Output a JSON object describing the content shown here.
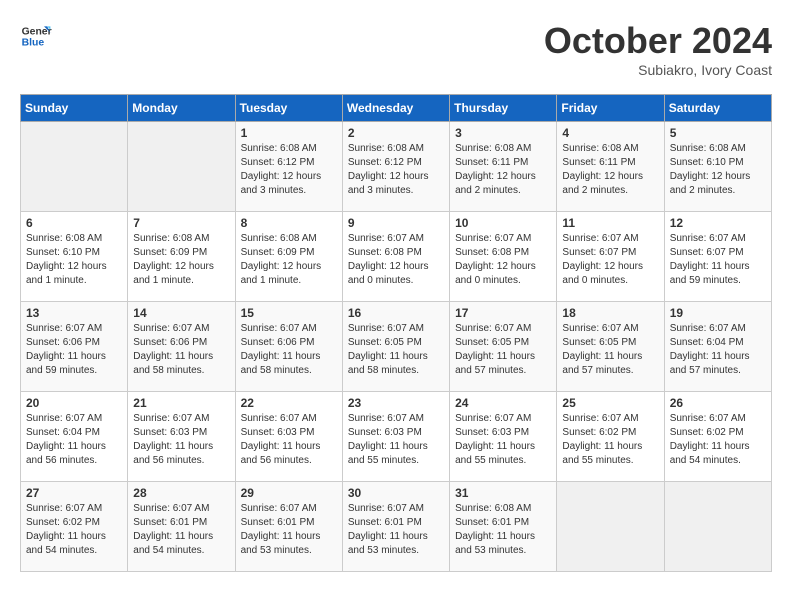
{
  "logo": {
    "line1": "General",
    "line2": "Blue"
  },
  "title": "October 2024",
  "subtitle": "Subiakro, Ivory Coast",
  "days_of_week": [
    "Sunday",
    "Monday",
    "Tuesday",
    "Wednesday",
    "Thursday",
    "Friday",
    "Saturday"
  ],
  "weeks": [
    [
      {
        "day": "",
        "info": ""
      },
      {
        "day": "",
        "info": ""
      },
      {
        "day": "1",
        "info": "Sunrise: 6:08 AM\nSunset: 6:12 PM\nDaylight: 12 hours and 3 minutes."
      },
      {
        "day": "2",
        "info": "Sunrise: 6:08 AM\nSunset: 6:12 PM\nDaylight: 12 hours and 3 minutes."
      },
      {
        "day": "3",
        "info": "Sunrise: 6:08 AM\nSunset: 6:11 PM\nDaylight: 12 hours and 2 minutes."
      },
      {
        "day": "4",
        "info": "Sunrise: 6:08 AM\nSunset: 6:11 PM\nDaylight: 12 hours and 2 minutes."
      },
      {
        "day": "5",
        "info": "Sunrise: 6:08 AM\nSunset: 6:10 PM\nDaylight: 12 hours and 2 minutes."
      }
    ],
    [
      {
        "day": "6",
        "info": "Sunrise: 6:08 AM\nSunset: 6:10 PM\nDaylight: 12 hours and 1 minute."
      },
      {
        "day": "7",
        "info": "Sunrise: 6:08 AM\nSunset: 6:09 PM\nDaylight: 12 hours and 1 minute."
      },
      {
        "day": "8",
        "info": "Sunrise: 6:08 AM\nSunset: 6:09 PM\nDaylight: 12 hours and 1 minute."
      },
      {
        "day": "9",
        "info": "Sunrise: 6:07 AM\nSunset: 6:08 PM\nDaylight: 12 hours and 0 minutes."
      },
      {
        "day": "10",
        "info": "Sunrise: 6:07 AM\nSunset: 6:08 PM\nDaylight: 12 hours and 0 minutes."
      },
      {
        "day": "11",
        "info": "Sunrise: 6:07 AM\nSunset: 6:07 PM\nDaylight: 12 hours and 0 minutes."
      },
      {
        "day": "12",
        "info": "Sunrise: 6:07 AM\nSunset: 6:07 PM\nDaylight: 11 hours and 59 minutes."
      }
    ],
    [
      {
        "day": "13",
        "info": "Sunrise: 6:07 AM\nSunset: 6:06 PM\nDaylight: 11 hours and 59 minutes."
      },
      {
        "day": "14",
        "info": "Sunrise: 6:07 AM\nSunset: 6:06 PM\nDaylight: 11 hours and 58 minutes."
      },
      {
        "day": "15",
        "info": "Sunrise: 6:07 AM\nSunset: 6:06 PM\nDaylight: 11 hours and 58 minutes."
      },
      {
        "day": "16",
        "info": "Sunrise: 6:07 AM\nSunset: 6:05 PM\nDaylight: 11 hours and 58 minutes."
      },
      {
        "day": "17",
        "info": "Sunrise: 6:07 AM\nSunset: 6:05 PM\nDaylight: 11 hours and 57 minutes."
      },
      {
        "day": "18",
        "info": "Sunrise: 6:07 AM\nSunset: 6:05 PM\nDaylight: 11 hours and 57 minutes."
      },
      {
        "day": "19",
        "info": "Sunrise: 6:07 AM\nSunset: 6:04 PM\nDaylight: 11 hours and 57 minutes."
      }
    ],
    [
      {
        "day": "20",
        "info": "Sunrise: 6:07 AM\nSunset: 6:04 PM\nDaylight: 11 hours and 56 minutes."
      },
      {
        "day": "21",
        "info": "Sunrise: 6:07 AM\nSunset: 6:03 PM\nDaylight: 11 hours and 56 minutes."
      },
      {
        "day": "22",
        "info": "Sunrise: 6:07 AM\nSunset: 6:03 PM\nDaylight: 11 hours and 56 minutes."
      },
      {
        "day": "23",
        "info": "Sunrise: 6:07 AM\nSunset: 6:03 PM\nDaylight: 11 hours and 55 minutes."
      },
      {
        "day": "24",
        "info": "Sunrise: 6:07 AM\nSunset: 6:03 PM\nDaylight: 11 hours and 55 minutes."
      },
      {
        "day": "25",
        "info": "Sunrise: 6:07 AM\nSunset: 6:02 PM\nDaylight: 11 hours and 55 minutes."
      },
      {
        "day": "26",
        "info": "Sunrise: 6:07 AM\nSunset: 6:02 PM\nDaylight: 11 hours and 54 minutes."
      }
    ],
    [
      {
        "day": "27",
        "info": "Sunrise: 6:07 AM\nSunset: 6:02 PM\nDaylight: 11 hours and 54 minutes."
      },
      {
        "day": "28",
        "info": "Sunrise: 6:07 AM\nSunset: 6:01 PM\nDaylight: 11 hours and 54 minutes."
      },
      {
        "day": "29",
        "info": "Sunrise: 6:07 AM\nSunset: 6:01 PM\nDaylight: 11 hours and 53 minutes."
      },
      {
        "day": "30",
        "info": "Sunrise: 6:07 AM\nSunset: 6:01 PM\nDaylight: 11 hours and 53 minutes."
      },
      {
        "day": "31",
        "info": "Sunrise: 6:08 AM\nSunset: 6:01 PM\nDaylight: 11 hours and 53 minutes."
      },
      {
        "day": "",
        "info": ""
      },
      {
        "day": "",
        "info": ""
      }
    ]
  ]
}
